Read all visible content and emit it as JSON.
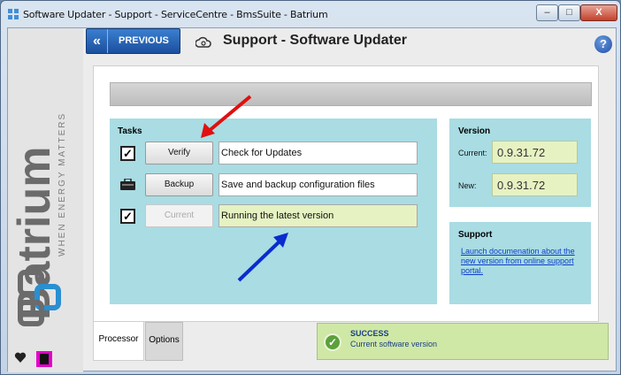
{
  "window": {
    "title": "Software Updater - Support - ServiceCentre - BmsSuite - Batrium",
    "controls": {
      "minimize": "–",
      "maximize": "□",
      "close": "X"
    }
  },
  "header": {
    "previous_label": "PREVIOUS",
    "previous_icon": "«",
    "title": "Support - Software Updater",
    "help_icon": "?"
  },
  "brand": {
    "logo_text": "Batrium",
    "tagline": "WHEN ENERGY MATTERS"
  },
  "tasks": {
    "title": "Tasks",
    "items": [
      {
        "icon": "checkbox-checked",
        "check_glyph": "✓",
        "button": "Verify",
        "text": "Check for Updates",
        "status": "normal"
      },
      {
        "icon": "briefcase-icon",
        "button": "Backup",
        "text": "Save and backup configuration files",
        "status": "normal"
      },
      {
        "icon": "checkbox-checked",
        "check_glyph": "✓",
        "button": "Current",
        "text": "Running the latest version",
        "status": "ok"
      }
    ]
  },
  "version": {
    "title": "Version",
    "current_label": "Current:",
    "current_value": "0.9.31.72",
    "new_label": "New:",
    "new_value": "0.9.31.72"
  },
  "support": {
    "title": "Support",
    "link_text": "Launch documenation about the new version from online support portal."
  },
  "tabs": {
    "processor": "Processor",
    "options": "Options"
  },
  "status": {
    "title": "SUCCESS",
    "message": "Current software version",
    "icon_glyph": "✓"
  },
  "colors": {
    "panel_cyan": "#a9dce3",
    "value_green": "#e6f2c2",
    "status_green": "#cfe8a5",
    "link_blue": "#0b3ec9",
    "primary_button": "#1c4f9e"
  },
  "annotations": {
    "red_arrow": "pointing to Verify button",
    "blue_arrow": "pointing to Running the latest version"
  }
}
